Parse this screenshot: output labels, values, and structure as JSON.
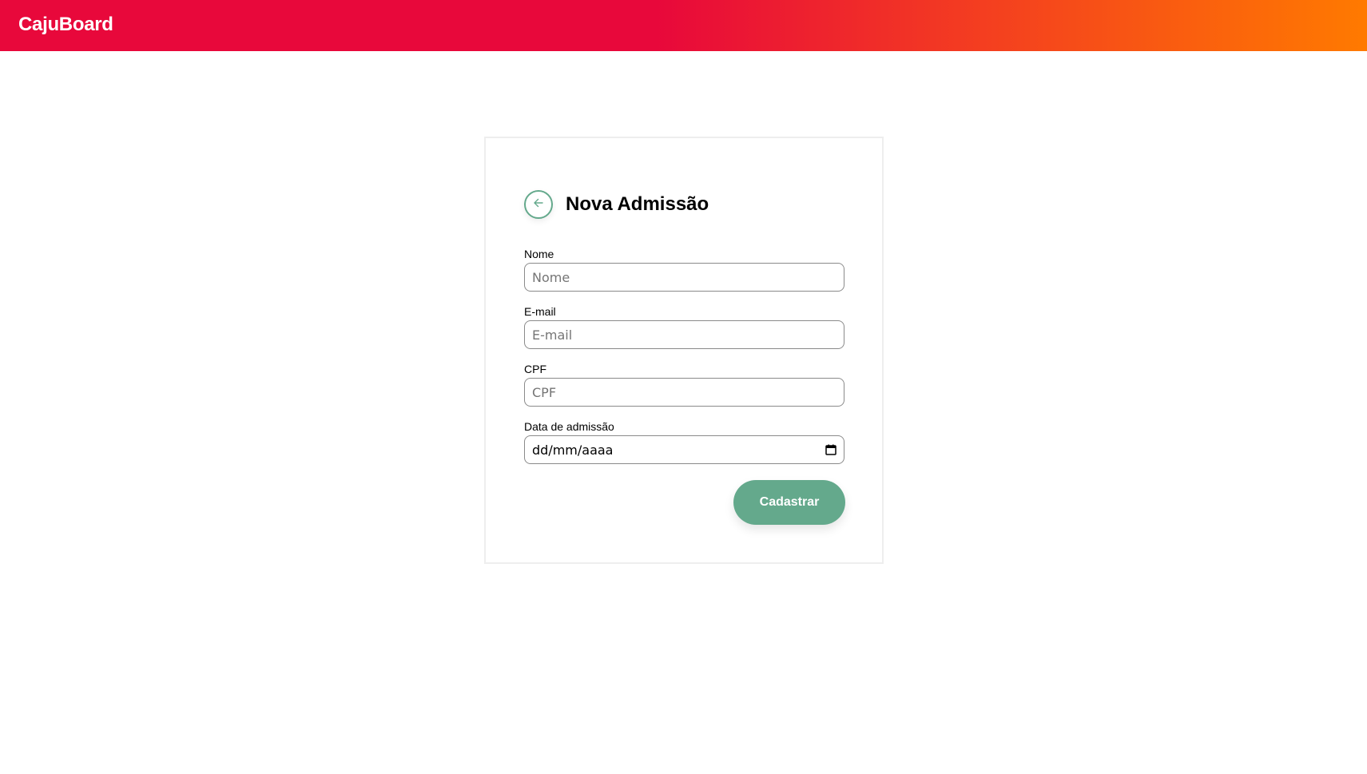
{
  "header": {
    "brand": "CajuBoard"
  },
  "form": {
    "title": "Nova Admissão",
    "fields": [
      {
        "label": "Nome",
        "placeholder": "Nome"
      },
      {
        "label": "E-mail",
        "placeholder": "E-mail"
      },
      {
        "label": "CPF",
        "placeholder": "CPF"
      },
      {
        "label": "Data de admissão",
        "value": "dd/mm/aaaa"
      }
    ],
    "submit_label": "Cadastrar"
  },
  "icons": {
    "back": "arrow-left-icon",
    "calendar": "calendar-icon"
  },
  "colors": {
    "header_gradient_start": "#e8083b",
    "header_gradient_end": "#ff7a00",
    "accent_green": "#64a98c"
  }
}
